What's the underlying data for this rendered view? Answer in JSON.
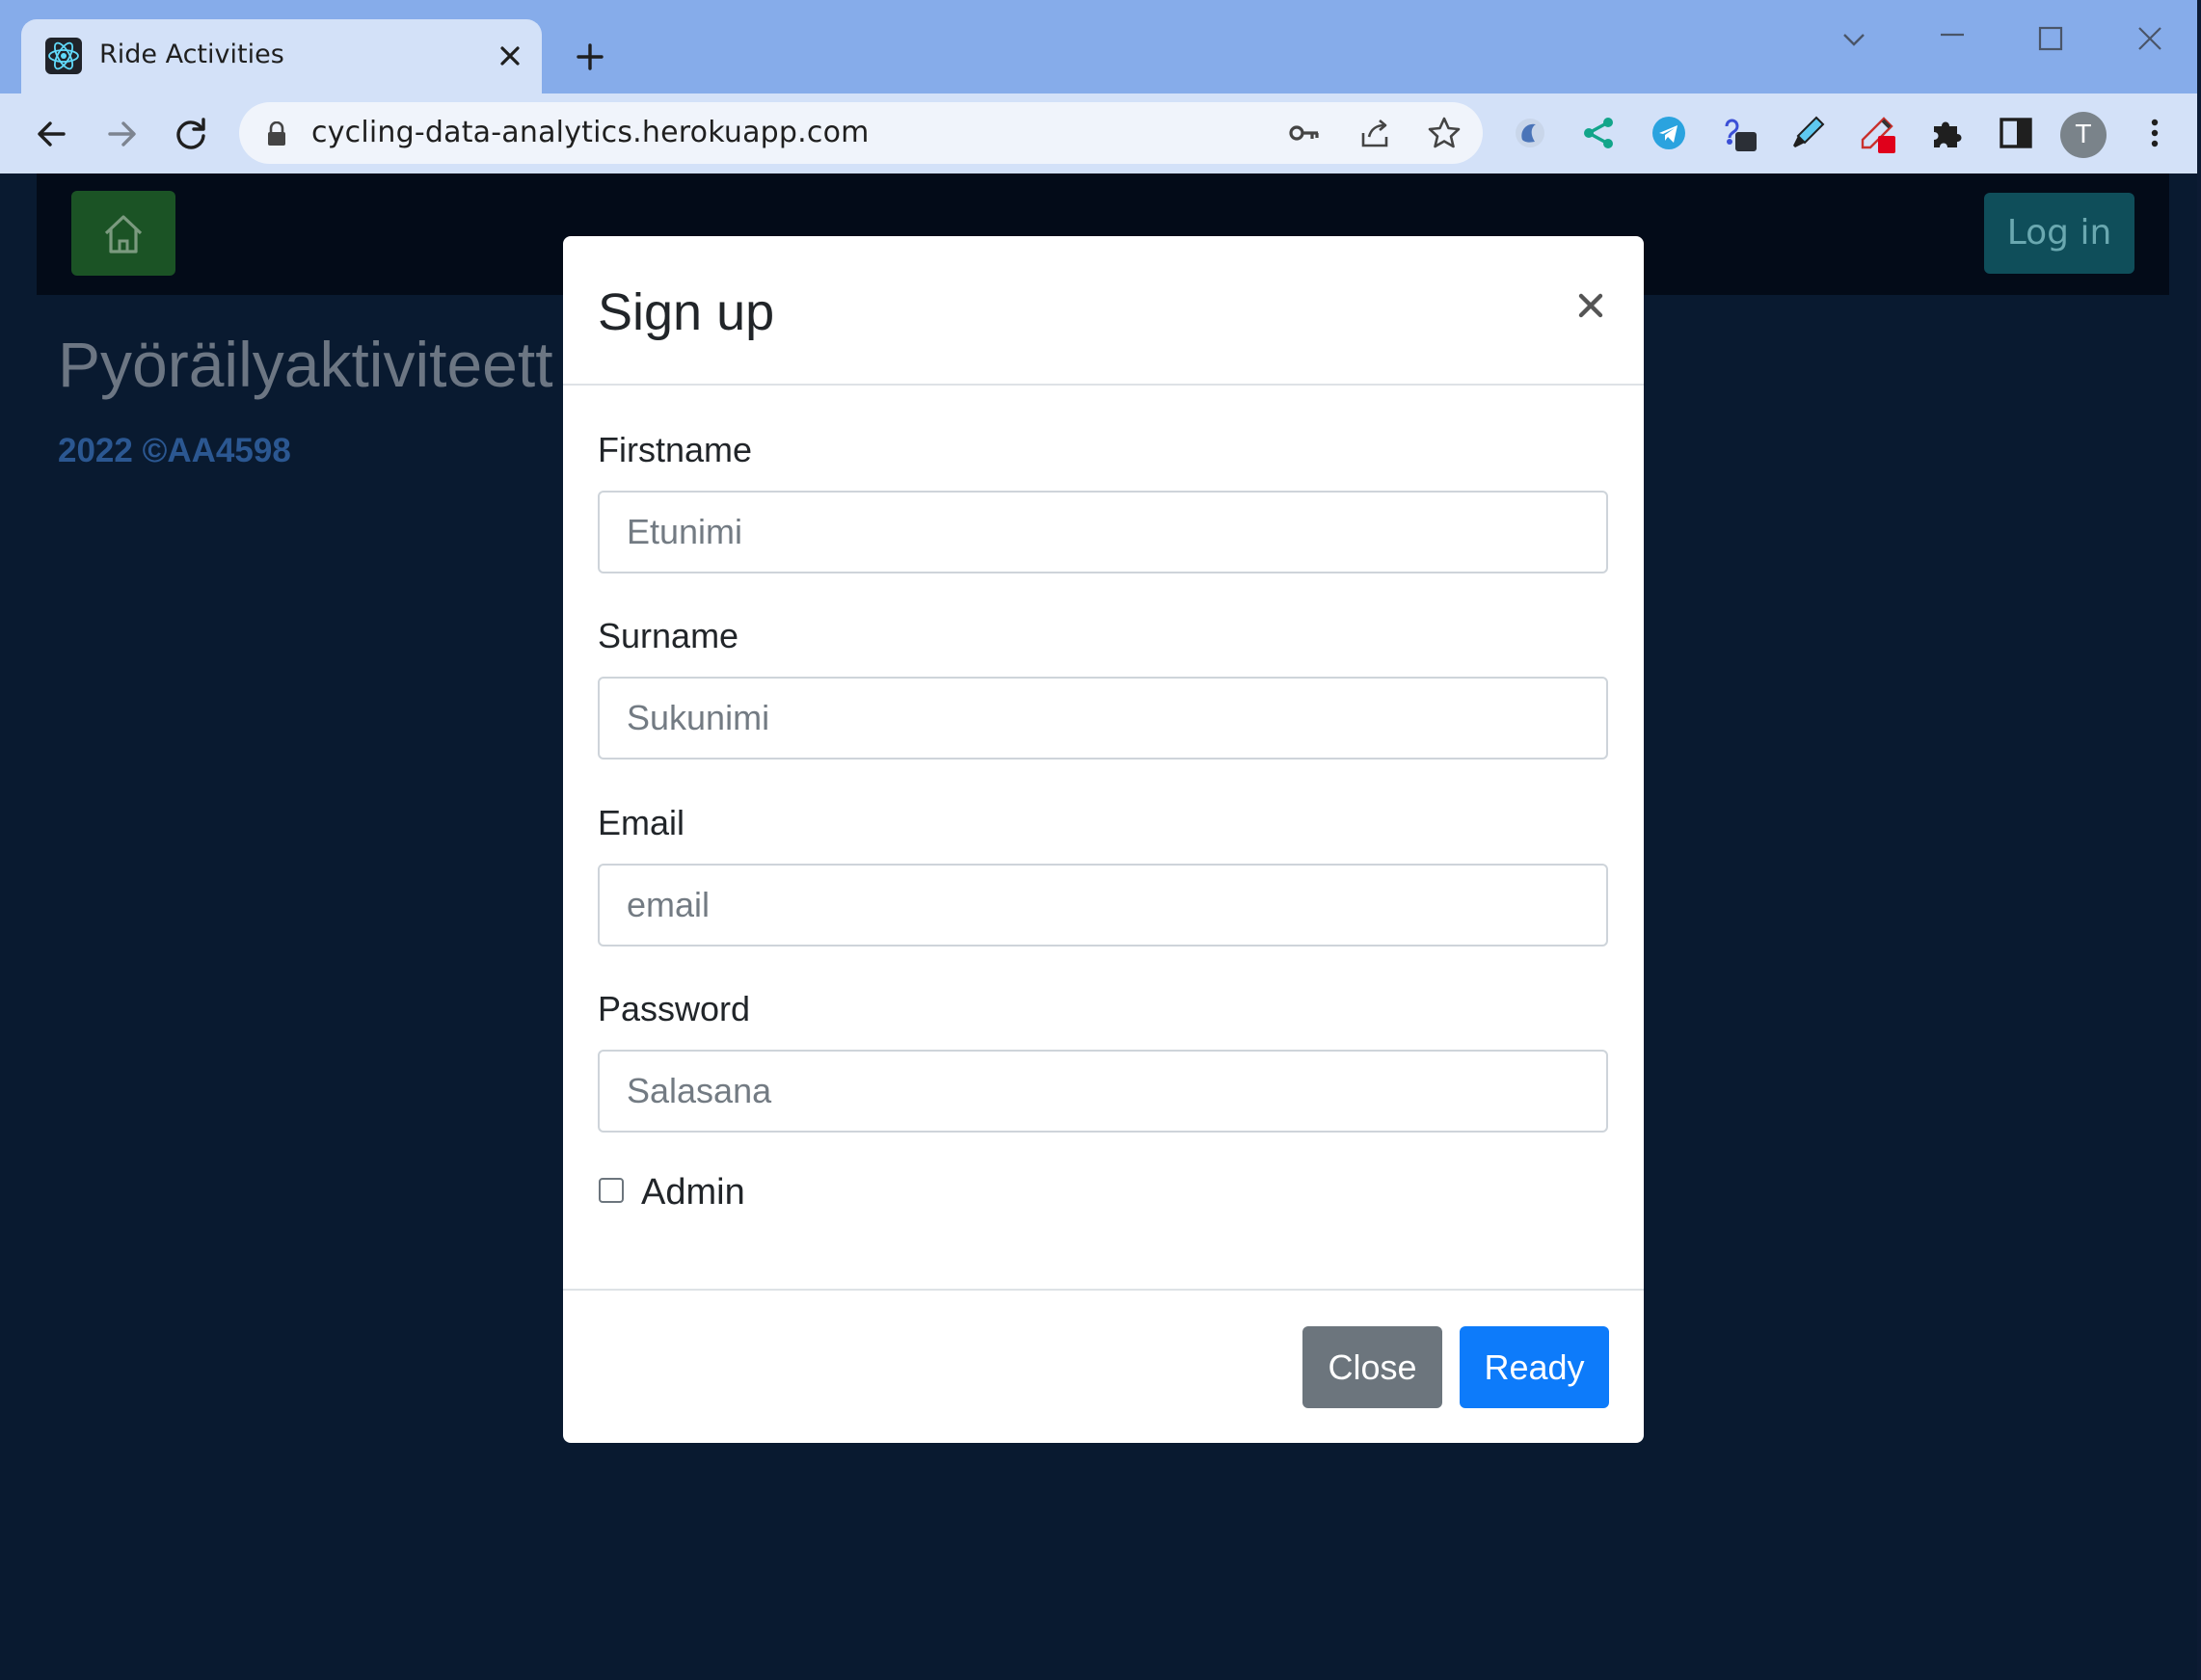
{
  "browser": {
    "tab_title": "Ride Activities",
    "url": "cycling-data-analytics.herokuapp.com",
    "profile_initial": "T",
    "extensions": [
      "extension-swirl-icon",
      "share-extension-icon",
      "telegram-icon",
      "link-extension-icon",
      "highlighter-icon",
      "eyedropper-icon",
      "puzzle-icon",
      "side-panel-icon"
    ]
  },
  "page": {
    "heading": "Pyöräilyaktiviteett",
    "footer": "2022 ©AA4598",
    "login_label": "Log in"
  },
  "modal": {
    "title": "Sign up",
    "fields": [
      {
        "label": "Firstname",
        "placeholder": "Etunimi"
      },
      {
        "label": "Surname",
        "placeholder": "Sukunimi"
      },
      {
        "label": "Email",
        "placeholder": "email"
      },
      {
        "label": "Password",
        "placeholder": "Salasana"
      }
    ],
    "admin_label": "Admin",
    "admin_checked": false,
    "close_label": "Close",
    "ready_label": "Ready"
  },
  "colors": {
    "primary": "#0d7bfa",
    "secondary": "#6c757d",
    "page_bg": "#091a30",
    "home_btn": "#1b5325",
    "login_btn": "#0f4e5a"
  }
}
